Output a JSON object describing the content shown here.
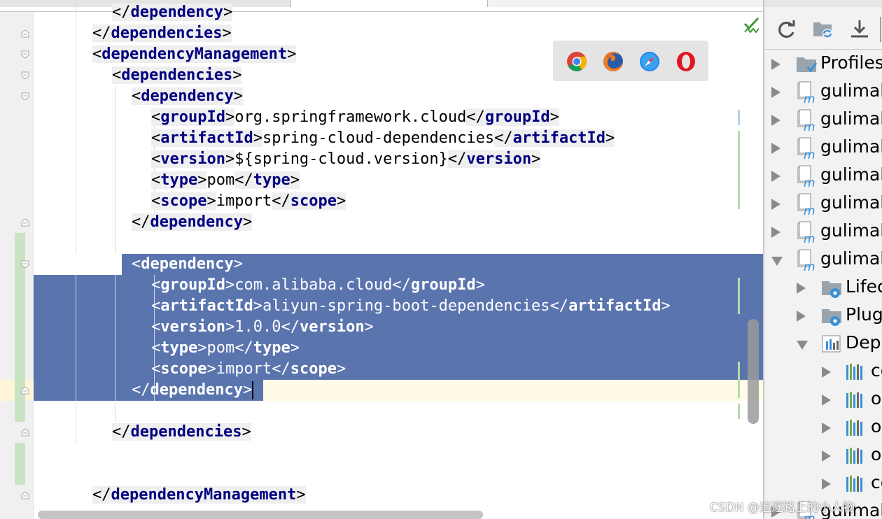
{
  "editor": {
    "lines": [
      {
        "indent": 4,
        "parts": [
          {
            "k": "tag",
            "open": false,
            "name": "dependency"
          }
        ]
      },
      {
        "indent": 2,
        "parts": [
          {
            "k": "tag",
            "open": false,
            "name": "dependencies"
          }
        ]
      },
      {
        "indent": 2,
        "parts": [
          {
            "k": "tag",
            "open": true,
            "name": "dependencyManagement"
          }
        ]
      },
      {
        "indent": 4,
        "parts": [
          {
            "k": "tag",
            "open": true,
            "name": "dependencies"
          }
        ]
      },
      {
        "indent": 6,
        "parts": [
          {
            "k": "tag",
            "open": true,
            "name": "dependency"
          }
        ]
      },
      {
        "indent": 8,
        "parts": [
          {
            "k": "tag",
            "open": true,
            "name": "groupId"
          },
          {
            "k": "text",
            "v": "org.springframework.cloud"
          },
          {
            "k": "tag",
            "open": false,
            "name": "groupId"
          }
        ]
      },
      {
        "indent": 8,
        "parts": [
          {
            "k": "tag",
            "open": true,
            "name": "artifactId"
          },
          {
            "k": "text",
            "v": "spring-cloud-dependencies"
          },
          {
            "k": "tag",
            "open": false,
            "name": "artifactId"
          }
        ]
      },
      {
        "indent": 8,
        "parts": [
          {
            "k": "tag",
            "open": true,
            "name": "version"
          },
          {
            "k": "text",
            "v": "${spring-cloud.version}"
          },
          {
            "k": "tag",
            "open": false,
            "name": "version"
          }
        ]
      },
      {
        "indent": 8,
        "parts": [
          {
            "k": "tag",
            "open": true,
            "name": "type"
          },
          {
            "k": "text",
            "v": "pom"
          },
          {
            "k": "tag",
            "open": false,
            "name": "type"
          }
        ]
      },
      {
        "indent": 8,
        "parts": [
          {
            "k": "tag",
            "open": true,
            "name": "scope"
          },
          {
            "k": "text",
            "v": "import"
          },
          {
            "k": "tag",
            "open": false,
            "name": "scope"
          }
        ]
      },
      {
        "indent": 6,
        "parts": [
          {
            "k": "tag",
            "open": false,
            "name": "dependency"
          }
        ]
      },
      {
        "indent": 0,
        "parts": []
      },
      {
        "indent": 6,
        "sel": true,
        "parts": [
          {
            "k": "tag",
            "open": true,
            "name": "dependency"
          }
        ]
      },
      {
        "indent": 8,
        "sel": true,
        "parts": [
          {
            "k": "tag",
            "open": true,
            "name": "groupId"
          },
          {
            "k": "text",
            "v": "com.alibaba.cloud"
          },
          {
            "k": "tag",
            "open": false,
            "name": "groupId"
          }
        ]
      },
      {
        "indent": 8,
        "sel": true,
        "parts": [
          {
            "k": "tag",
            "open": true,
            "name": "artifactId"
          },
          {
            "k": "text",
            "v": "aliyun-spring-boot-dependencies"
          },
          {
            "k": "tag",
            "open": false,
            "name": "artifactId"
          }
        ]
      },
      {
        "indent": 8,
        "sel": true,
        "parts": [
          {
            "k": "tag",
            "open": true,
            "name": "version"
          },
          {
            "k": "text",
            "v": "1.0.0"
          },
          {
            "k": "tag",
            "open": false,
            "name": "version"
          }
        ]
      },
      {
        "indent": 8,
        "sel": true,
        "parts": [
          {
            "k": "tag",
            "open": true,
            "name": "type"
          },
          {
            "k": "text",
            "v": "pom"
          },
          {
            "k": "tag",
            "open": false,
            "name": "type"
          }
        ]
      },
      {
        "indent": 8,
        "sel": true,
        "parts": [
          {
            "k": "tag",
            "open": true,
            "name": "scope"
          },
          {
            "k": "text",
            "v": "import"
          },
          {
            "k": "tag",
            "open": false,
            "name": "scope"
          }
        ]
      },
      {
        "indent": 6,
        "sel": true,
        "caret": true,
        "parts": [
          {
            "k": "tag",
            "open": false,
            "name": "dependency"
          }
        ]
      },
      {
        "indent": 0,
        "parts": []
      },
      {
        "indent": 4,
        "parts": [
          {
            "k": "tag",
            "open": false,
            "name": "dependencies"
          }
        ]
      },
      {
        "indent": 0,
        "parts": []
      },
      {
        "indent": 0,
        "parts": []
      },
      {
        "indent": 2,
        "parts": [
          {
            "k": "tag",
            "open": false,
            "name": "dependencyManagement"
          }
        ]
      }
    ]
  },
  "browsers": [
    {
      "name": "chrome-icon"
    },
    {
      "name": "firefox-icon"
    },
    {
      "name": "safari-icon"
    },
    {
      "name": "opera-icon"
    }
  ],
  "maven": {
    "toolbar": [
      {
        "name": "reload-icon"
      },
      {
        "name": "generate-sources-icon"
      },
      {
        "name": "download-icon"
      }
    ],
    "tree": [
      {
        "label": "Profiles",
        "level": 0,
        "expanded": false,
        "icon": "folder-profiles-icon"
      },
      {
        "label": "gulimal",
        "level": 0,
        "expanded": false,
        "icon": "maven-module-icon"
      },
      {
        "label": "gulimal",
        "level": 0,
        "expanded": false,
        "icon": "maven-module-icon"
      },
      {
        "label": "gulimal",
        "level": 0,
        "expanded": false,
        "icon": "maven-module-icon"
      },
      {
        "label": "gulimal",
        "level": 0,
        "expanded": false,
        "icon": "maven-module-icon"
      },
      {
        "label": "gulimal",
        "level": 0,
        "expanded": false,
        "icon": "maven-module-icon"
      },
      {
        "label": "gulimal",
        "level": 0,
        "expanded": false,
        "icon": "maven-module-icon"
      },
      {
        "label": "gulimal",
        "level": 0,
        "expanded": true,
        "icon": "maven-module-icon"
      },
      {
        "label": "Lifec",
        "level": 1,
        "expanded": false,
        "icon": "folder-gear-icon"
      },
      {
        "label": "Plug",
        "level": 1,
        "expanded": false,
        "icon": "folder-gear-icon"
      },
      {
        "label": "Depe",
        "level": 1,
        "expanded": true,
        "icon": "dependencies-icon"
      },
      {
        "label": "co",
        "level": 2,
        "expanded": false,
        "icon": "library-icon"
      },
      {
        "label": "o",
        "level": 2,
        "expanded": false,
        "icon": "library-icon"
      },
      {
        "label": "o",
        "level": 2,
        "expanded": false,
        "icon": "library-icon"
      },
      {
        "label": "o",
        "level": 2,
        "expanded": false,
        "icon": "library-icon"
      },
      {
        "label": "co",
        "level": 2,
        "expanded": false,
        "icon": "library-icon"
      },
      {
        "label": "gulimal",
        "level": 0,
        "expanded": false,
        "icon": "maven-module-icon"
      }
    ]
  },
  "watermark": "CSDN @追逐路上的小人物"
}
